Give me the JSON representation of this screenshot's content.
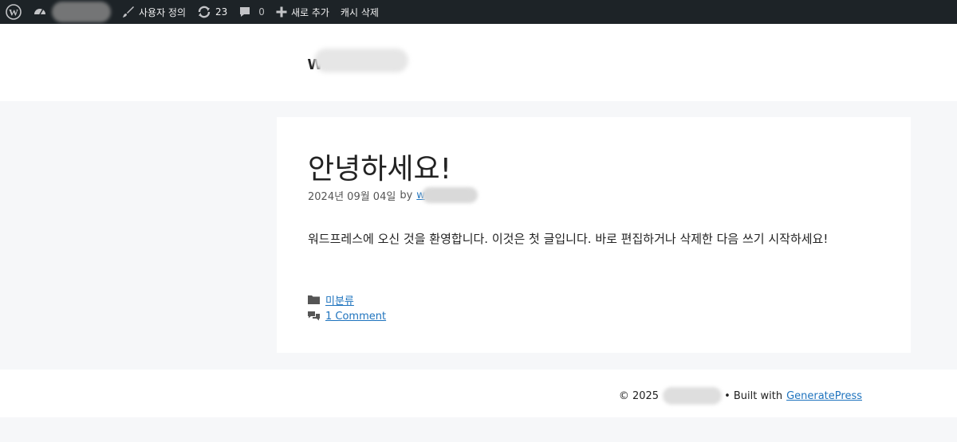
{
  "adminbar": {
    "customize_label": "사용자 정의",
    "updates_count": "23",
    "comments_count": "0",
    "new_label": "새로 추가",
    "cache_label": "캐시 삭제"
  },
  "site": {
    "title": "w"
  },
  "post": {
    "title": "안녕하세요!",
    "date": "2024년 09월 04일",
    "by": "by",
    "author": "w",
    "content": "워드프레스에 오신 것을 환영합니다. 이것은 첫 글입니다. 바로 편집하거나 삭제한 다음 쓰기 시작하세요!",
    "category": "미분류",
    "comments_link": "1 Comment"
  },
  "footer": {
    "copyright": "© 2025",
    "built_with": "• Built with",
    "theme_link": "GeneratePress"
  },
  "colors": {
    "adminbar_bg": "#1d2327",
    "link": "#1e73be",
    "page_bg": "#f6f7f9"
  }
}
